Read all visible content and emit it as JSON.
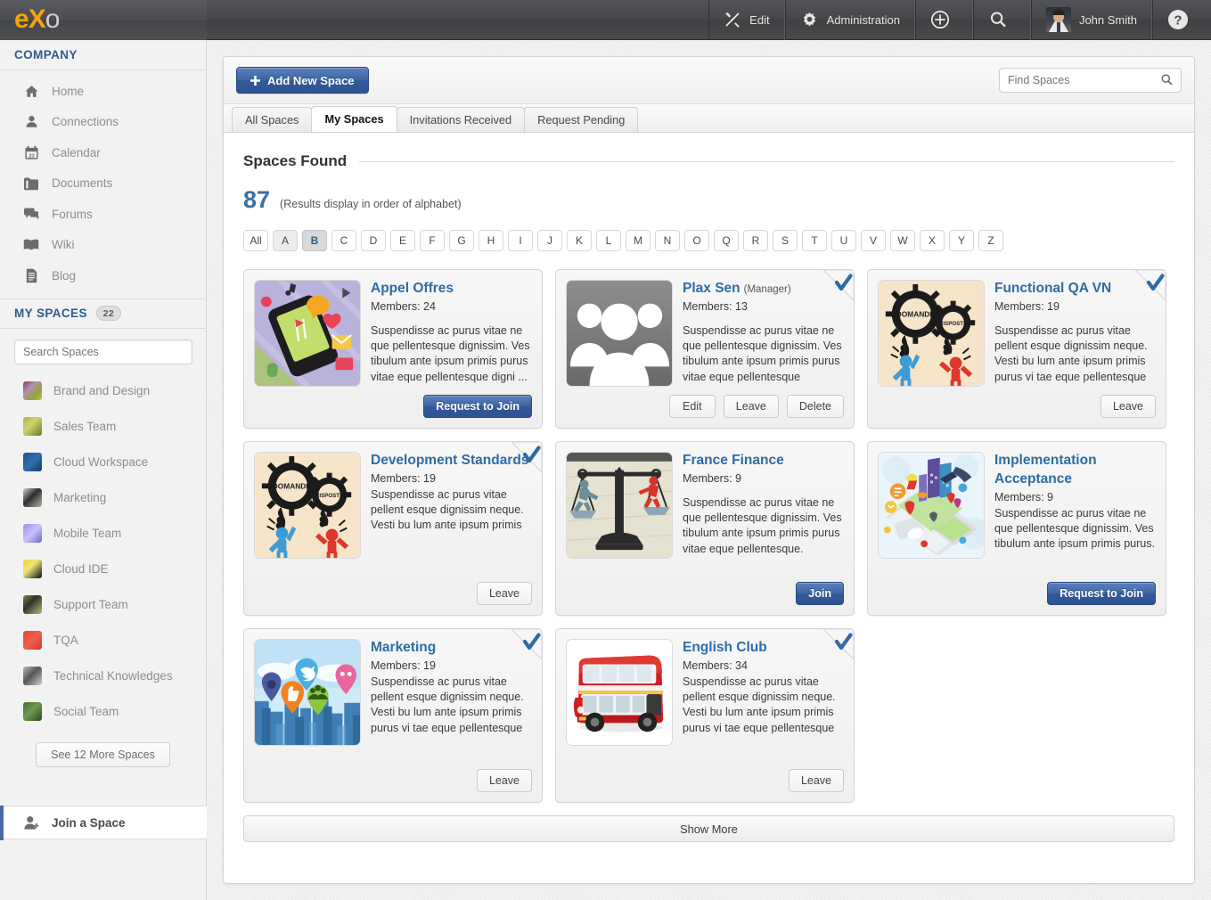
{
  "topbar": {
    "logo": {
      "part1": "e",
      "part2": "X",
      "part3": "o"
    },
    "items": [
      {
        "label": "Edit",
        "icon": "tools-icon"
      },
      {
        "label": "Administration",
        "icon": "gear-icon"
      },
      {
        "label": "",
        "icon": "plus-circle-icon"
      },
      {
        "label": "",
        "icon": "search-icon"
      },
      {
        "label": "John Smith",
        "icon": "avatar"
      },
      {
        "label": "",
        "icon": "help-icon"
      }
    ]
  },
  "sidebar": {
    "company_header": "COMPANY",
    "nav": [
      {
        "label": "Home",
        "icon": "home-icon"
      },
      {
        "label": "Connections",
        "icon": "person-icon"
      },
      {
        "label": "Calendar",
        "icon": "calendar-icon"
      },
      {
        "label": "Documents",
        "icon": "folder-icon"
      },
      {
        "label": "Forums",
        "icon": "chat-icon"
      },
      {
        "label": "Wiki",
        "icon": "book-icon"
      },
      {
        "label": "Blog",
        "icon": "document-icon"
      }
    ],
    "my_spaces_header": "MY SPACES",
    "my_spaces_count": "22",
    "search_placeholder": "Search Spaces",
    "spaces": [
      {
        "label": "Brand and Design",
        "thumb": "th-brand"
      },
      {
        "label": "Sales Team",
        "thumb": "th-sales"
      },
      {
        "label": "Cloud Workspace",
        "thumb": "th-cloudw"
      },
      {
        "label": "Marketing",
        "thumb": "th-mkt"
      },
      {
        "label": "Mobile Team",
        "thumb": "th-mobile"
      },
      {
        "label": "Cloud IDE",
        "thumb": "th-ide"
      },
      {
        "label": "Support Team",
        "thumb": "th-support"
      },
      {
        "label": "TQA",
        "thumb": "th-tqa"
      },
      {
        "label": "Technical Knowledges",
        "thumb": "th-tech"
      },
      {
        "label": "Social Team",
        "thumb": "th-social"
      }
    ],
    "see_more_label": "See 12 More Spaces",
    "join_space_label": "Join a Space"
  },
  "toolbar": {
    "add_space_label": "Add New Space",
    "find_placeholder": "Find Spaces"
  },
  "tabs": [
    {
      "label": "All Spaces",
      "active": false
    },
    {
      "label": "My Spaces",
      "active": true
    },
    {
      "label": "Invitations Received",
      "active": false
    },
    {
      "label": "Request Pending",
      "active": false
    }
  ],
  "results": {
    "section_title": "Spaces Found",
    "count": "87",
    "note": "(Results display in order of alphabet)",
    "alphabet": [
      "All",
      "A",
      "B",
      "C",
      "D",
      "E",
      "F",
      "G",
      "H",
      "I",
      "J",
      "K",
      "L",
      "M",
      "N",
      "O",
      "Q",
      "R",
      "S",
      "T",
      "U",
      "V",
      "W",
      "X",
      "Y",
      "Z"
    ],
    "alphabet_active": "B",
    "alphabet_hover": "A"
  },
  "cards": [
    {
      "title": "Appel Offres",
      "role": "",
      "members": "Members: 24",
      "desc": "Suspendisse ac purus vitae ne que pellentesque dignissim. Ves tibulum ante ipsum primis purus vitae eque pellentesque digni ...",
      "member_badge": false,
      "thumb": "phone-map",
      "buttons": [
        {
          "label": "Request to Join",
          "style": "blue"
        }
      ]
    },
    {
      "title": "Plax Sen",
      "role": "(Manager)",
      "members": "Members: 13",
      "desc": "Suspendisse ac purus vitae ne que pellentesque dignissim. Ves tibulum ante ipsum primis purus vitae eque pellentesque",
      "member_badge": true,
      "thumb": "people",
      "buttons": [
        {
          "label": "Edit",
          "style": "plain"
        },
        {
          "label": "Leave",
          "style": "plain"
        },
        {
          "label": "Delete",
          "style": "plain"
        }
      ]
    },
    {
      "title": "Functional QA VN",
      "role": "",
      "members": "Members: 19",
      "desc": "Suspendisse ac purus vitae pellent esque dignissim neque. Vesti bu lum ante ipsum primis purus vi tae eque pellentesque",
      "member_badge": true,
      "thumb": "gears",
      "buttons": [
        {
          "label": "Leave",
          "style": "plain"
        }
      ]
    },
    {
      "title": "Development Standards",
      "role": "",
      "members": "Members: 19",
      "desc": "Suspendisse ac purus vitae pellent esque dignissim neque. Vesti bu lum ante ipsum primis",
      "member_badge": true,
      "thumb": "gears",
      "buttons": [
        {
          "label": "Leave",
          "style": "plain"
        }
      ]
    },
    {
      "title": "France Finance",
      "role": "",
      "members": "Members: 9",
      "desc": "Suspendisse ac purus vitae ne que pellentesque dignissim. Ves tibulum ante ipsum primis purus vitae eque pellentesque.",
      "member_badge": false,
      "thumb": "scales",
      "buttons": [
        {
          "label": "Join",
          "style": "blue"
        }
      ]
    },
    {
      "title": "Implementation Acceptance",
      "role": "",
      "members": "Members: 9",
      "desc": "Suspendisse ac purus vitae ne que pellentesque dignissim. Ves tibulum ante ipsum primis purus.",
      "member_badge": false,
      "thumb": "city-phone",
      "buttons": [
        {
          "label": "Request to Join",
          "style": "blue"
        }
      ]
    },
    {
      "title": "Marketing",
      "role": "",
      "members": "Members: 19",
      "desc": "Suspendisse ac purus vitae pellent esque dignissim neque. Vesti bu lum ante ipsum primis purus vi tae eque pellentesque",
      "member_badge": true,
      "thumb": "pins",
      "buttons": [
        {
          "label": "Leave",
          "style": "plain"
        }
      ]
    },
    {
      "title": "English Club",
      "role": "",
      "members": "Members: 34",
      "desc": "Suspendisse ac purus vitae pellent esque dignissim neque. Vesti bu lum ante ipsum primis purus vi tae eque pellentesque",
      "member_badge": true,
      "thumb": "bus",
      "buttons": [
        {
          "label": "Leave",
          "style": "plain"
        }
      ]
    }
  ],
  "footer": {
    "show_more_label": "Show More"
  },
  "colors": {
    "accent_blue": "#2f6ba5",
    "primary_button": "#3c64a4",
    "logo_orange": "#f5a30a",
    "sidebar_heading": "#2f5b8c"
  }
}
